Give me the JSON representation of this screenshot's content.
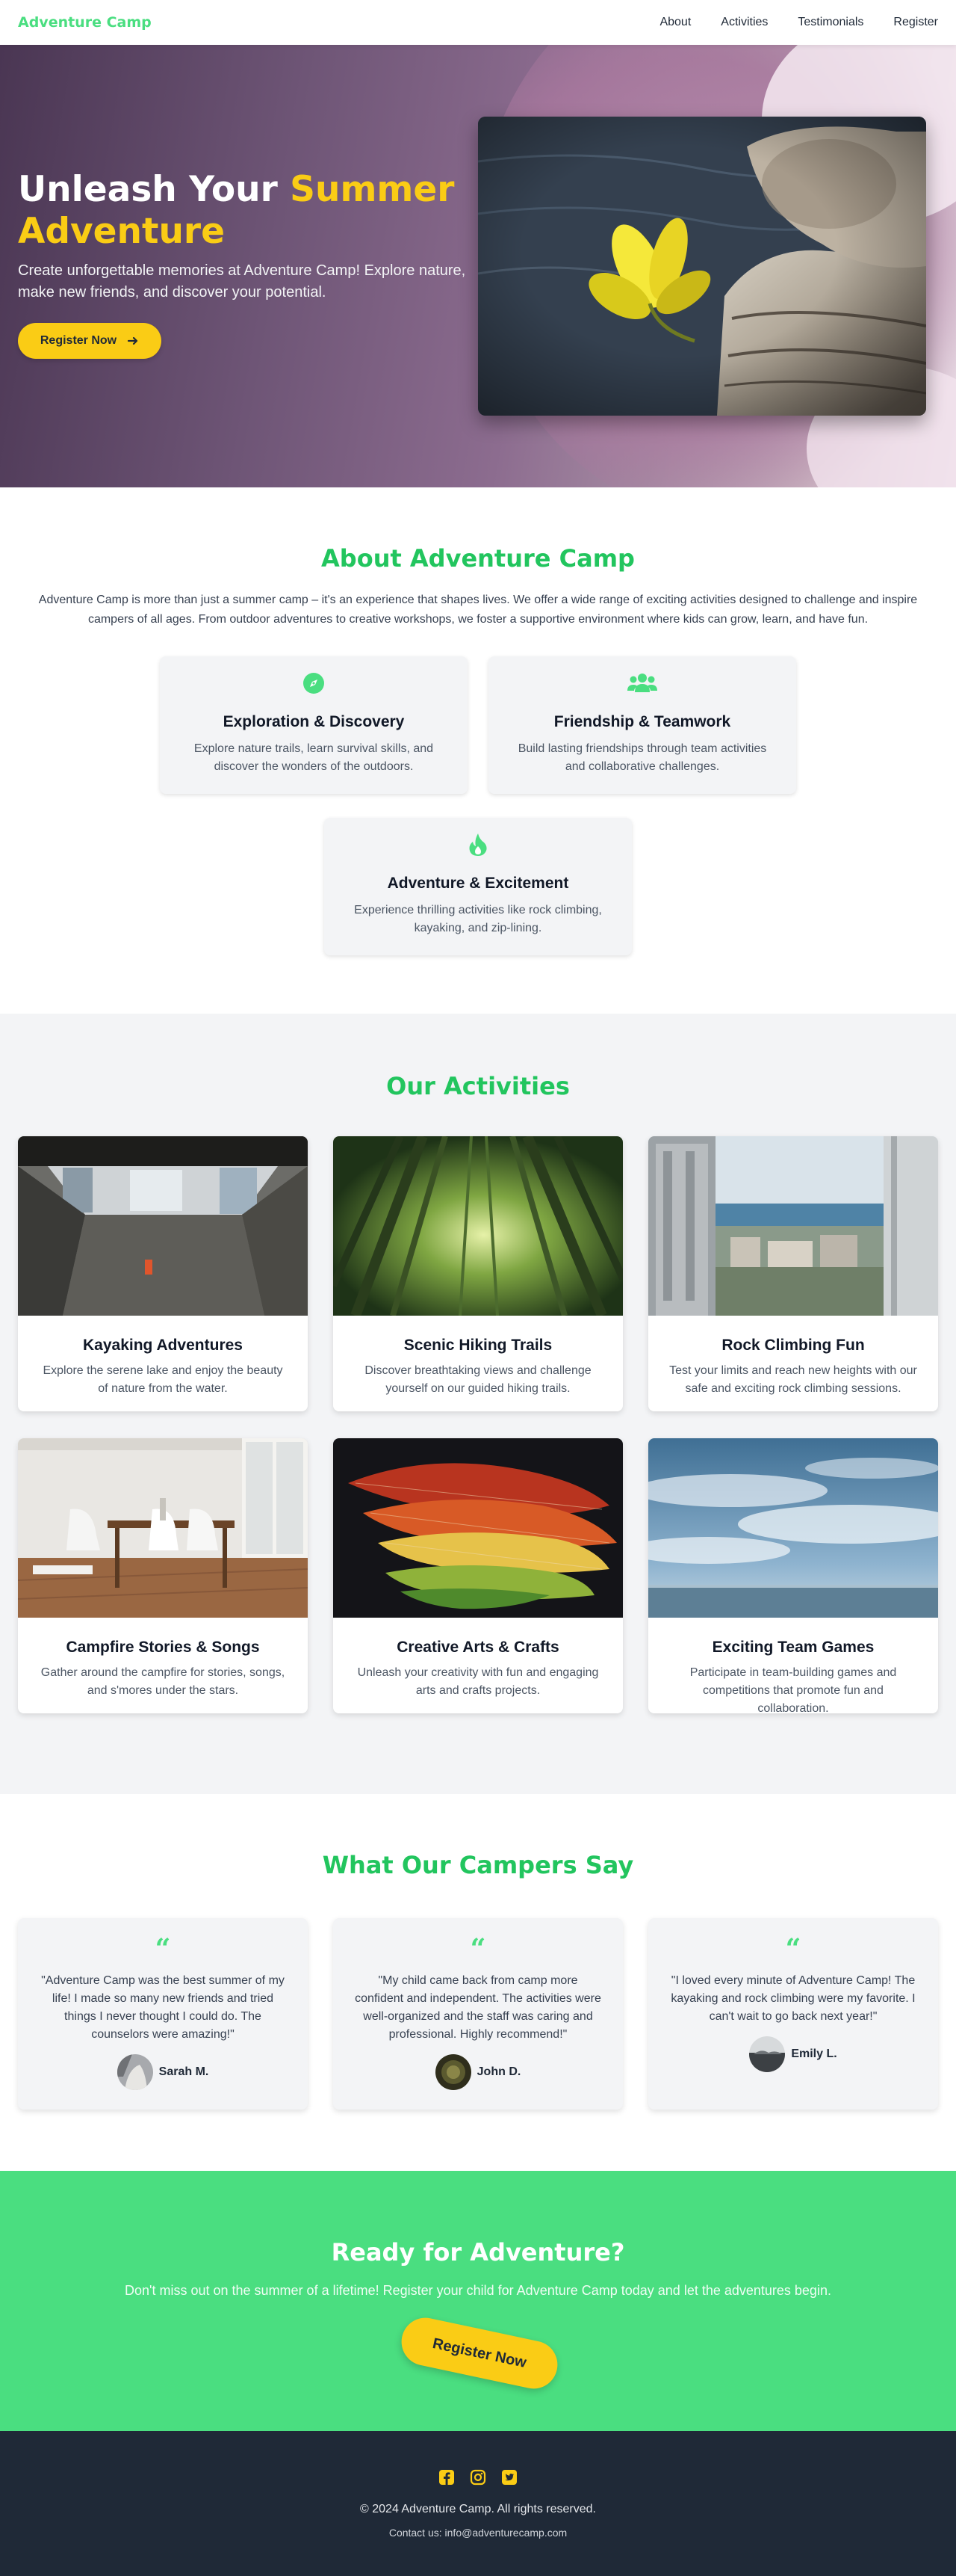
{
  "nav": {
    "brand": "Adventure Camp",
    "links": [
      "About",
      "Activities",
      "Testimonials",
      "Register"
    ]
  },
  "hero": {
    "title_main": "Unleash Your ",
    "title_accent": "Summer Adventure",
    "subtitle": "Create unforgettable memories at Adventure Camp! Explore nature, make new friends, and discover your potential.",
    "cta_label": "Register Now",
    "cta_icon": "arrow-right-icon",
    "image_icon": "flower-on-tree-stump-photo"
  },
  "about": {
    "title": "About Adventure Camp",
    "text": "Adventure Camp is more than just a summer camp – it's an experience that shapes lives. We offer a wide range of exciting activities designed to challenge and inspire campers of all ages. From outdoor adventures to creative workshops, we foster a supportive environment where kids can grow, learn, and have fun.",
    "features": [
      {
        "icon": "compass-icon",
        "title": "Exploration & Discovery",
        "text": "Explore nature trails, learn survival skills, and discover the wonders of the outdoors."
      },
      {
        "icon": "users-icon",
        "title": "Friendship & Teamwork",
        "text": "Build lasting friendships through team activities and collaborative challenges."
      },
      {
        "icon": "fire-icon",
        "title": "Adventure & Excitement",
        "text": "Experience thrilling activities like rock climbing, kayaking, and zip-lining."
      }
    ]
  },
  "activities": {
    "title": "Our Activities",
    "items": [
      {
        "title": "Kayaking Adventures",
        "text": "Explore the serene lake and enjoy the beauty of nature from the water."
      },
      {
        "title": "Scenic Hiking Trails",
        "text": "Discover breathtaking views and challenge yourself on our guided hiking trails."
      },
      {
        "title": "Rock Climbing Fun",
        "text": "Test your limits and reach new heights with our safe and exciting rock climbing sessions."
      },
      {
        "title": "Campfire Stories & Songs",
        "text": "Gather around the campfire for stories, songs, and s'mores under the stars."
      },
      {
        "title": "Creative Arts & Crafts",
        "text": "Unleash your creativity with fun and engaging arts and crafts projects."
      },
      {
        "title": "Exciting Team Games",
        "text": "Participate in team-building games and competitions that promote fun and collaboration."
      }
    ]
  },
  "testimonials": {
    "title": "What Our Campers Say",
    "quote_icon": "quote-left-icon",
    "items": [
      {
        "text": "\"Adventure Camp was the best summer of my life! I made so many new friends and tried things I never thought I could do. The counselors were amazing!\"",
        "name": "Sarah M."
      },
      {
        "text": "\"My child came back from camp more confident and independent. The activities were well-organized and the staff was caring and professional. Highly recommend!\"",
        "name": "John D."
      },
      {
        "text": "\"I loved every minute of Adventure Camp! The kayaking and rock climbing were my favorite. I can't wait to go back next year!\"",
        "name": "Emily L."
      }
    ]
  },
  "cta": {
    "title": "Ready for Adventure?",
    "text": "Don't miss out on the summer of a lifetime! Register your child for Adventure Camp today and let the adventures begin.",
    "button": "Register Now"
  },
  "footer": {
    "socials": [
      "facebook-icon",
      "instagram-icon",
      "twitter-icon"
    ],
    "copyright": "© 2024 Adventure Camp. All rights reserved.",
    "contact": "Contact us: info@adventurecamp.com"
  },
  "colors": {
    "brand_green": "#4ade80",
    "heading_green": "#22c55e",
    "accent_yellow": "#facc15",
    "footer_dark": "#1f2937"
  }
}
